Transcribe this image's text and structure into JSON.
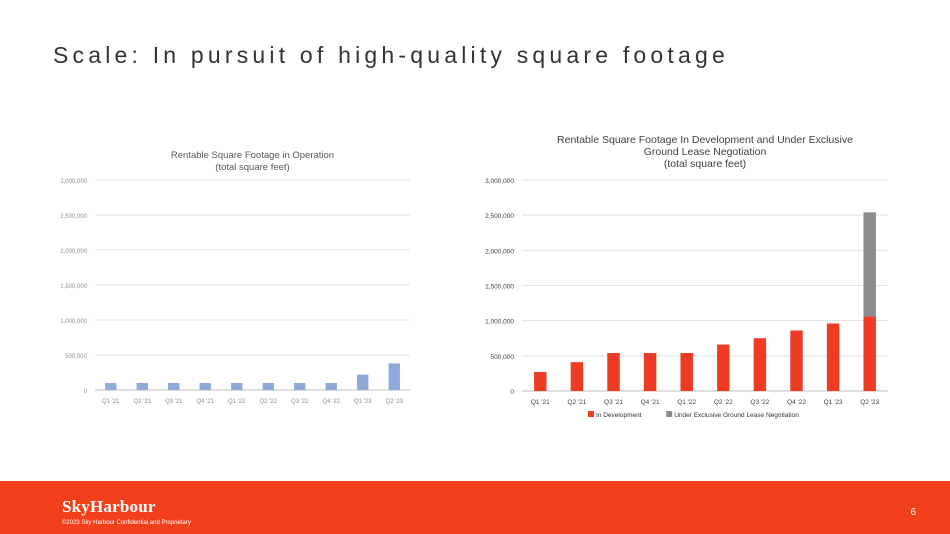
{
  "page": {
    "title": "Scale: In pursuit of high-quality square footage",
    "page_number": "6"
  },
  "footer": {
    "brand": "SkyHarbour",
    "copyright": "©2023 Sky Harbour Confidential and Proprietary",
    "background_color": "#f2401c"
  },
  "chart_data": [
    {
      "type": "bar",
      "title": "Rentable Square Footage in Operation",
      "subtitle": "(total square feet)",
      "categories": [
        "Q1 '21",
        "Q2 '21",
        "Q3 '21",
        "Q4 '21",
        "Q1 '22",
        "Q2 '22",
        "Q3 '22",
        "Q4 '22",
        "Q1 '23",
        "Q2 '23"
      ],
      "values": [
        100000,
        100000,
        100000,
        100000,
        100000,
        100000,
        100000,
        100000,
        220000,
        380000
      ],
      "ylim": [
        0,
        3000000
      ],
      "yticks": [
        0,
        500000,
        1000000,
        1500000,
        2000000,
        2500000,
        3000000
      ],
      "ytick_labels": [
        "0",
        "500,000",
        "1,000,000",
        "1,500,000",
        "2,000,000",
        "2,500,000",
        "3,000,000"
      ],
      "grid": true,
      "color": "#8eaadb"
    },
    {
      "type": "bar",
      "stacked": true,
      "title": "Rentable Square Footage In Development and Under Exclusive Ground Lease Negotiation",
      "title_lines": [
        "Rentable Square Footage In Development and Under Exclusive",
        "Ground Lease Negotiation",
        "(total square feet)"
      ],
      "categories": [
        "Q1 '21",
        "Q2 '21",
        "Q3 '21",
        "Q4 '21",
        "Q1 '22",
        "Q2 '22",
        "Q3 '22",
        "Q4 '22",
        "Q1 '23",
        "Q2 '23"
      ],
      "series": [
        {
          "name": "In Development",
          "values": [
            270000,
            410000,
            540000,
            540000,
            540000,
            660000,
            750000,
            860000,
            960000,
            1060000
          ],
          "color": "#ee3b24"
        },
        {
          "name": "Under Exclusive Ground Lease Negotiation",
          "values": [
            0,
            0,
            0,
            0,
            0,
            0,
            0,
            0,
            0,
            1480000
          ],
          "color": "#8c8c8c"
        }
      ],
      "ylim": [
        0,
        3000000
      ],
      "yticks": [
        0,
        500000,
        1000000,
        1500000,
        2000000,
        2500000,
        3000000
      ],
      "ytick_labels": [
        "0",
        "500,000",
        "1,000,000",
        "1,500,000",
        "2,000,000",
        "2,500,000",
        "3,000,000"
      ],
      "grid": true,
      "legend": "bottom"
    }
  ]
}
